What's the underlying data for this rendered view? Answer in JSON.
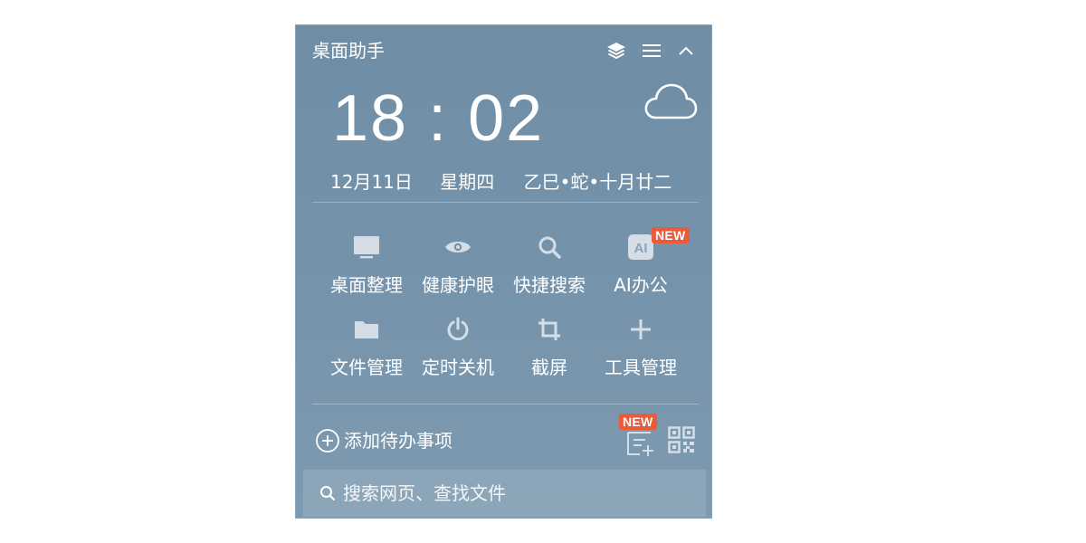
{
  "widget": {
    "title": "桌面助手",
    "header_buttons": [
      {
        "icon": "layers-icon"
      },
      {
        "icon": "menu-icon"
      },
      {
        "icon": "chevron-up-icon"
      }
    ]
  },
  "clock": {
    "time": "18 : 02",
    "weather_icon": "cloud-icon",
    "date": "12月11日",
    "weekday": "星期四",
    "lunar": "乙巳•蛇•十月廿二"
  },
  "tools": [
    {
      "label": "桌面整理",
      "icon": "monitor-icon"
    },
    {
      "label": "健康护眼",
      "icon": "eye-icon"
    },
    {
      "label": "快捷搜索",
      "icon": "search-icon"
    },
    {
      "label": "AI办公",
      "icon": "ai-icon",
      "badge": "NEW",
      "icon_text": "AI"
    },
    {
      "label": "文件管理",
      "icon": "folder-icon"
    },
    {
      "label": "定时关机",
      "icon": "power-icon"
    },
    {
      "label": "截屏",
      "icon": "crop-icon"
    },
    {
      "label": "工具管理",
      "icon": "plus-icon"
    }
  ],
  "todo": {
    "label": "添加待办事项",
    "list_badge": "NEW"
  },
  "search": {
    "placeholder": "搜索网页、查找文件"
  },
  "colors": {
    "background_top": "#6f8ea5",
    "background_bottom": "#7e9ab0",
    "badge": "#ea5b3c",
    "text": "#ffffff"
  }
}
